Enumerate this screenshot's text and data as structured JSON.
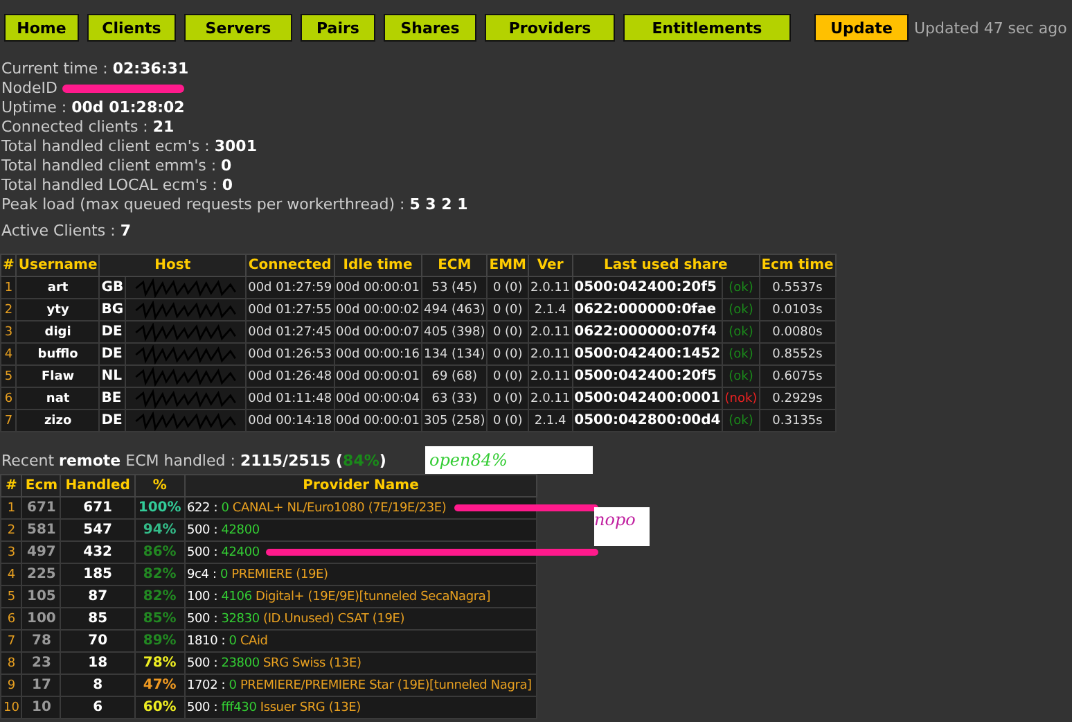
{
  "nav": [
    {
      "label": "Home",
      "kind": "link"
    },
    {
      "label": "Clients",
      "kind": "link"
    },
    {
      "label": "Servers",
      "kind": "link"
    },
    {
      "label": "Pairs",
      "kind": "link"
    },
    {
      "label": "Shares",
      "kind": "link"
    },
    {
      "label": "Providers",
      "kind": "link"
    },
    {
      "label": "Entitlements",
      "kind": "link"
    },
    {
      "label": "Update",
      "kind": "update"
    }
  ],
  "updated": "Updated 47 sec ago",
  "info": [
    {
      "kind": "plain",
      "label": "Current time : ",
      "value": "02:36:31"
    },
    {
      "kind": "redacted",
      "label": "NodeID"
    },
    {
      "kind": "plain",
      "label": "Uptime : ",
      "value": "00d 01:28:02"
    },
    {
      "kind": "plain",
      "label": "Connected clients : ",
      "value": "21"
    },
    {
      "kind": "plain",
      "label": "Total handled client ecm's : ",
      "value": "3001"
    },
    {
      "kind": "plain",
      "label": "Total handled client emm's : ",
      "value": "0"
    },
    {
      "kind": "plain",
      "label": "Total handled LOCAL ecm's : ",
      "value": "0"
    },
    {
      "kind": "plain",
      "label": "Peak load (max queued requests per workerthread) : ",
      "value": "5 3 2 1"
    }
  ],
  "active_clients": {
    "label": "Active Clients : ",
    "value": "7"
  },
  "clients_table": {
    "columns": [
      "#",
      "Username",
      "Host",
      "Connected",
      "Idle time",
      "ECM",
      "EMM",
      "Ver",
      "Last used share",
      "Ecm time"
    ],
    "rows": [
      {
        "n": "1",
        "user": "art",
        "country": "GB",
        "connected": "00d 01:27:59",
        "idle": "00d 00:00:01",
        "ecm": "53 (45)",
        "emm": "0 (0)",
        "ver": "2.0.11",
        "share": "0500:042400:20f5",
        "status": "(ok)",
        "ok": true,
        "ecm_time": "0.5537s"
      },
      {
        "n": "2",
        "user": "yty",
        "country": "BG",
        "connected": "00d 01:27:55",
        "idle": "00d 00:00:02",
        "ecm": "494 (463)",
        "emm": "0 (0)",
        "ver": "2.1.4",
        "share": "0622:000000:0fae",
        "status": "(ok)",
        "ok": true,
        "ecm_time": "0.0103s"
      },
      {
        "n": "3",
        "user": "digi",
        "country": "DE",
        "connected": "00d 01:27:45",
        "idle": "00d 00:00:07",
        "ecm": "405 (398)",
        "emm": "0 (0)",
        "ver": "2.0.11",
        "share": "0622:000000:07f4",
        "status": "(ok)",
        "ok": true,
        "ecm_time": "0.0080s"
      },
      {
        "n": "4",
        "user": "bufflo",
        "country": "DE",
        "connected": "00d 01:26:53",
        "idle": "00d 00:00:16",
        "ecm": "134 (134)",
        "emm": "0 (0)",
        "ver": "2.0.11",
        "share": "0500:042400:1452",
        "status": "(ok)",
        "ok": true,
        "ecm_time": "0.8552s"
      },
      {
        "n": "5",
        "user": "Flaw",
        "country": "NL",
        "connected": "00d 01:26:48",
        "idle": "00d 00:00:01",
        "ecm": "69 (68)",
        "emm": "0 (0)",
        "ver": "2.0.11",
        "share": "0500:042400:20f5",
        "status": "(ok)",
        "ok": true,
        "ecm_time": "0.6075s"
      },
      {
        "n": "6",
        "user": "nat",
        "country": "BE",
        "connected": "00d 01:11:48",
        "idle": "00d 00:00:04",
        "ecm": "63 (33)",
        "emm": "0 (0)",
        "ver": "2.0.11",
        "share": "0500:042400:0001",
        "status": "(nok)",
        "ok": false,
        "ecm_time": "0.2929s"
      },
      {
        "n": "7",
        "user": "zizo",
        "country": "DE",
        "connected": "00d 00:14:18",
        "idle": "00d 00:00:01",
        "ecm": "305 (258)",
        "emm": "0 (0)",
        "ver": "2.1.4",
        "share": "0500:042800:00d4",
        "status": "(ok)",
        "ok": true,
        "ecm_time": "0.3135s"
      }
    ]
  },
  "recent": {
    "label": "Recent **remote** ECM handled : ",
    "handled": "2115",
    "total": "/2515",
    "open": " (",
    "pct": "84%",
    "close": ")"
  },
  "notes": [
    {
      "text": "open84%"
    },
    {
      "text": "nopo"
    }
  ],
  "providers_table": {
    "columns": [
      "#",
      "Ecm",
      "Handled",
      "%",
      "Provider Name"
    ],
    "rows": [
      {
        "n": "1",
        "ecm": "671",
        "handled": "671",
        "pct": "100%",
        "color": "#33cc99",
        "caid": "622 : ",
        "provid": "0",
        "name": " CANAL+ NL/Euro1080 (7E/19E/23E)",
        "struck": true
      },
      {
        "n": "2",
        "ecm": "581",
        "handled": "547",
        "pct": "94%",
        "color": "#33bb88",
        "caid": "500 : ",
        "provid": "42800",
        "name": "",
        "struck": false
      },
      {
        "n": "3",
        "ecm": "497",
        "handled": "432",
        "pct": "86%",
        "color": "#228822",
        "caid": "500 : ",
        "provid": "42400",
        "name": "",
        "struck": true
      },
      {
        "n": "4",
        "ecm": "225",
        "handled": "185",
        "pct": "82%",
        "color": "#228822",
        "caid": "9c4 : ",
        "provid": "0",
        "name": " PREMIERE (19E)",
        "struck": false
      },
      {
        "n": "5",
        "ecm": "105",
        "handled": "87",
        "pct": "82%",
        "color": "#228822",
        "caid": "100 : ",
        "provid": "4106",
        "name": " Digital+ (19E/9E)[tunneled SecaNagra]",
        "struck": false
      },
      {
        "n": "6",
        "ecm": "100",
        "handled": "85",
        "pct": "85%",
        "color": "#228822",
        "caid": "500 : ",
        "provid": "32830",
        "name": " (ID.Unused) CSAT (19E)",
        "struck": false
      },
      {
        "n": "7",
        "ecm": "78",
        "handled": "70",
        "pct": "89%",
        "color": "#228822",
        "caid": "1810 : ",
        "provid": "0",
        "name": " CAid",
        "struck": false
      },
      {
        "n": "8",
        "ecm": "23",
        "handled": "18",
        "pct": "78%",
        "color": "#eeee22",
        "caid": "500 : ",
        "provid": "23800",
        "name": " SRG Swiss (13E)",
        "struck": false
      },
      {
        "n": "9",
        "ecm": "17",
        "handled": "8",
        "pct": "47%",
        "color": "#ee9922",
        "caid": "1702 : ",
        "provid": "0",
        "name": " PREMIERE/PREMIERE Star (19E)[tunneled Nagra]",
        "struck": false
      },
      {
        "n": "10",
        "ecm": "10",
        "handled": "6",
        "pct": "60%",
        "color": "#eeee22",
        "caid": "500 : ",
        "provid": "fff430",
        "name": " Issuer SRG (13E)",
        "struck": false
      }
    ]
  }
}
